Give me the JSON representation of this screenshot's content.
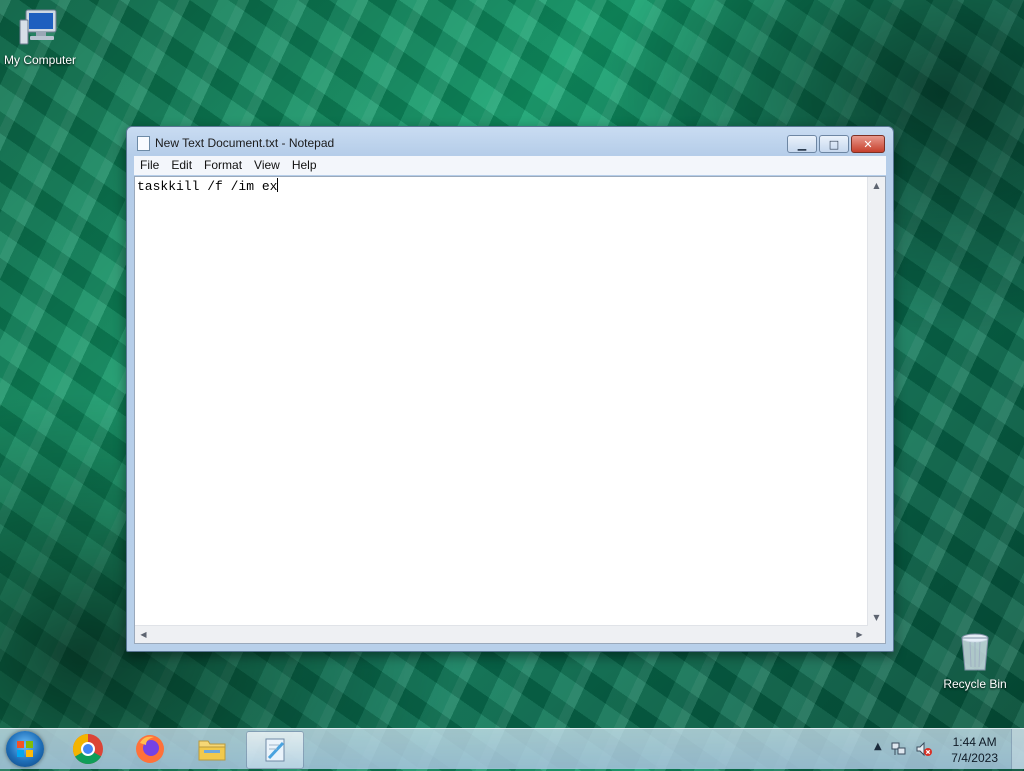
{
  "desktop": {
    "icons": [
      {
        "label": "My Computer",
        "icon": "computer-icon"
      },
      {
        "label": "Recycle Bin",
        "icon": "recycle-bin-icon"
      }
    ]
  },
  "window": {
    "title": "New Text Document.txt - Notepad",
    "menu": [
      "File",
      "Edit",
      "Format",
      "View",
      "Help"
    ],
    "content": "taskkill /f /im ex",
    "caption_buttons": {
      "minimize": "minimize-icon",
      "maximize": "maximize-icon",
      "close": "close-icon"
    }
  },
  "taskbar": {
    "pinned": [
      {
        "name": "Google Chrome",
        "icon": "chrome-icon"
      },
      {
        "name": "Firefox",
        "icon": "firefox-icon"
      },
      {
        "name": "File Explorer",
        "icon": "folder-icon"
      },
      {
        "name": "Notepad",
        "icon": "notepad-icon",
        "active": true
      }
    ],
    "clock": {
      "time": "1:44 AM",
      "date": "7/4/2023"
    }
  }
}
